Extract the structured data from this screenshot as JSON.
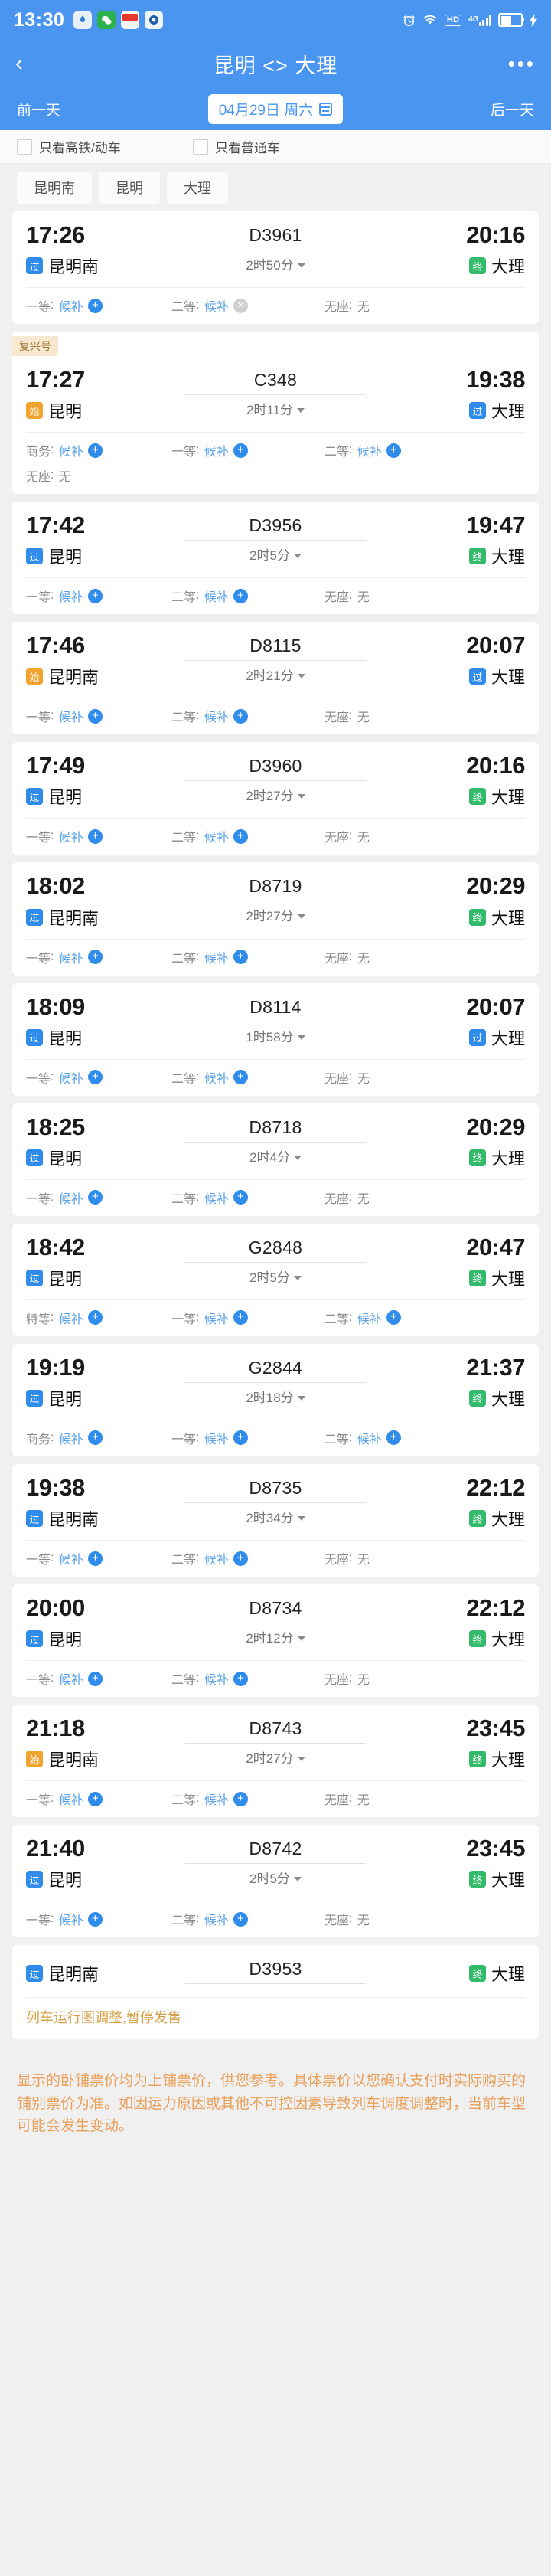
{
  "status_bar": {
    "time": "13:30",
    "app_icons": [
      "weather-icon",
      "wechat-icon",
      "toutiao-icon",
      "eye-icon"
    ],
    "right_icons": [
      "alarm-icon",
      "wifi-icon",
      "hd-icon",
      "signal-4g-icon",
      "battery-icon",
      "charging-icon"
    ],
    "hd_label": "HD",
    "network_label": "4G"
  },
  "nav": {
    "back_icon": "back-chevron-icon",
    "title": "昆明 <> 大理",
    "more_icon": "more-dots-icon"
  },
  "date_bar": {
    "prev_label": "前一天",
    "date_label": "04月29日 周六",
    "calendar_icon": "calendar-icon",
    "next_label": "后一天"
  },
  "filters": [
    {
      "label": "只看高铁/动车",
      "checked": false
    },
    {
      "label": "只看普通车",
      "checked": false
    }
  ],
  "station_tabs": [
    "昆明南",
    "昆明",
    "大理"
  ],
  "labels": {
    "fuxing_tag": "复兴号",
    "badge_pass": "过",
    "badge_start": "始",
    "badge_end": "终",
    "wait_text": "候补",
    "none_text": "无"
  },
  "trains": [
    {
      "tag": null,
      "depart_time": "17:26",
      "depart_station": "昆明南",
      "depart_badge": "过",
      "depart_badge_type": "guo",
      "code": "D3961",
      "duration": "2时50分",
      "arrive_time": "20:16",
      "arrive_station": "大理",
      "arrive_badge": "终",
      "arrive_badge_type": "zhong",
      "seat_rows": [
        [
          {
            "name": "一等",
            "value": "候补",
            "icon": "plus"
          },
          {
            "name": "二等",
            "value": "候补",
            "icon": "cross"
          },
          {
            "name": "无座",
            "value": "无",
            "icon": "none"
          }
        ]
      ],
      "notice": null
    },
    {
      "tag": "复兴号",
      "depart_time": "17:27",
      "depart_station": "昆明",
      "depart_badge": "始",
      "depart_badge_type": "shi",
      "code": "C348",
      "duration": "2时11分",
      "arrive_time": "19:38",
      "arrive_station": "大理",
      "arrive_badge": "过",
      "arrive_badge_type": "guo",
      "seat_rows": [
        [
          {
            "name": "商务",
            "value": "候补",
            "icon": "plus"
          },
          {
            "name": "一等",
            "value": "候补",
            "icon": "plus"
          },
          {
            "name": "二等",
            "value": "候补",
            "icon": "plus"
          }
        ],
        [
          {
            "name": "无座",
            "value": "无",
            "icon": "none"
          }
        ]
      ],
      "notice": null
    },
    {
      "tag": null,
      "depart_time": "17:42",
      "depart_station": "昆明",
      "depart_badge": "过",
      "depart_badge_type": "guo",
      "code": "D3956",
      "duration": "2时5分",
      "arrive_time": "19:47",
      "arrive_station": "大理",
      "arrive_badge": "终",
      "arrive_badge_type": "zhong",
      "seat_rows": [
        [
          {
            "name": "一等",
            "value": "候补",
            "icon": "plus"
          },
          {
            "name": "二等",
            "value": "候补",
            "icon": "plus"
          },
          {
            "name": "无座",
            "value": "无",
            "icon": "none"
          }
        ]
      ],
      "notice": null
    },
    {
      "tag": null,
      "depart_time": "17:46",
      "depart_station": "昆明南",
      "depart_badge": "始",
      "depart_badge_type": "shi",
      "code": "D8115",
      "duration": "2时21分",
      "arrive_time": "20:07",
      "arrive_station": "大理",
      "arrive_badge": "过",
      "arrive_badge_type": "guo",
      "seat_rows": [
        [
          {
            "name": "一等",
            "value": "候补",
            "icon": "plus"
          },
          {
            "name": "二等",
            "value": "候补",
            "icon": "plus"
          },
          {
            "name": "无座",
            "value": "无",
            "icon": "none"
          }
        ]
      ],
      "notice": null
    },
    {
      "tag": null,
      "depart_time": "17:49",
      "depart_station": "昆明",
      "depart_badge": "过",
      "depart_badge_type": "guo",
      "code": "D3960",
      "duration": "2时27分",
      "arrive_time": "20:16",
      "arrive_station": "大理",
      "arrive_badge": "终",
      "arrive_badge_type": "zhong",
      "seat_rows": [
        [
          {
            "name": "一等",
            "value": "候补",
            "icon": "plus"
          },
          {
            "name": "二等",
            "value": "候补",
            "icon": "plus"
          },
          {
            "name": "无座",
            "value": "无",
            "icon": "none"
          }
        ]
      ],
      "notice": null
    },
    {
      "tag": null,
      "depart_time": "18:02",
      "depart_station": "昆明南",
      "depart_badge": "过",
      "depart_badge_type": "guo",
      "code": "D8719",
      "duration": "2时27分",
      "arrive_time": "20:29",
      "arrive_station": "大理",
      "arrive_badge": "终",
      "arrive_badge_type": "zhong",
      "seat_rows": [
        [
          {
            "name": "一等",
            "value": "候补",
            "icon": "plus"
          },
          {
            "name": "二等",
            "value": "候补",
            "icon": "plus"
          },
          {
            "name": "无座",
            "value": "无",
            "icon": "none"
          }
        ]
      ],
      "notice": null
    },
    {
      "tag": null,
      "depart_time": "18:09",
      "depart_station": "昆明",
      "depart_badge": "过",
      "depart_badge_type": "guo",
      "code": "D8114",
      "duration": "1时58分",
      "arrive_time": "20:07",
      "arrive_station": "大理",
      "arrive_badge": "过",
      "arrive_badge_type": "guo",
      "seat_rows": [
        [
          {
            "name": "一等",
            "value": "候补",
            "icon": "plus"
          },
          {
            "name": "二等",
            "value": "候补",
            "icon": "plus"
          },
          {
            "name": "无座",
            "value": "无",
            "icon": "none"
          }
        ]
      ],
      "notice": null
    },
    {
      "tag": null,
      "depart_time": "18:25",
      "depart_station": "昆明",
      "depart_badge": "过",
      "depart_badge_type": "guo",
      "code": "D8718",
      "duration": "2时4分",
      "arrive_time": "20:29",
      "arrive_station": "大理",
      "arrive_badge": "终",
      "arrive_badge_type": "zhong",
      "seat_rows": [
        [
          {
            "name": "一等",
            "value": "候补",
            "icon": "plus"
          },
          {
            "name": "二等",
            "value": "候补",
            "icon": "plus"
          },
          {
            "name": "无座",
            "value": "无",
            "icon": "none"
          }
        ]
      ],
      "notice": null
    },
    {
      "tag": null,
      "depart_time": "18:42",
      "depart_station": "昆明",
      "depart_badge": "过",
      "depart_badge_type": "guo",
      "code": "G2848",
      "duration": "2时5分",
      "arrive_time": "20:47",
      "arrive_station": "大理",
      "arrive_badge": "终",
      "arrive_badge_type": "zhong",
      "seat_rows": [
        [
          {
            "name": "特等",
            "value": "候补",
            "icon": "plus"
          },
          {
            "name": "一等",
            "value": "候补",
            "icon": "plus"
          },
          {
            "name": "二等",
            "value": "候补",
            "icon": "plus"
          }
        ]
      ],
      "notice": null
    },
    {
      "tag": null,
      "depart_time": "19:19",
      "depart_station": "昆明",
      "depart_badge": "过",
      "depart_badge_type": "guo",
      "code": "G2844",
      "duration": "2时18分",
      "arrive_time": "21:37",
      "arrive_station": "大理",
      "arrive_badge": "终",
      "arrive_badge_type": "zhong",
      "seat_rows": [
        [
          {
            "name": "商务",
            "value": "候补",
            "icon": "plus"
          },
          {
            "name": "一等",
            "value": "候补",
            "icon": "plus"
          },
          {
            "name": "二等",
            "value": "候补",
            "icon": "plus"
          }
        ]
      ],
      "notice": null
    },
    {
      "tag": null,
      "depart_time": "19:38",
      "depart_station": "昆明南",
      "depart_badge": "过",
      "depart_badge_type": "guo",
      "code": "D8735",
      "duration": "2时34分",
      "arrive_time": "22:12",
      "arrive_station": "大理",
      "arrive_badge": "终",
      "arrive_badge_type": "zhong",
      "seat_rows": [
        [
          {
            "name": "一等",
            "value": "候补",
            "icon": "plus"
          },
          {
            "name": "二等",
            "value": "候补",
            "icon": "plus"
          },
          {
            "name": "无座",
            "value": "无",
            "icon": "none"
          }
        ]
      ],
      "notice": null
    },
    {
      "tag": null,
      "depart_time": "20:00",
      "depart_station": "昆明",
      "depart_badge": "过",
      "depart_badge_type": "guo",
      "code": "D8734",
      "duration": "2时12分",
      "arrive_time": "22:12",
      "arrive_station": "大理",
      "arrive_badge": "终",
      "arrive_badge_type": "zhong",
      "seat_rows": [
        [
          {
            "name": "一等",
            "value": "候补",
            "icon": "plus"
          },
          {
            "name": "二等",
            "value": "候补",
            "icon": "plus"
          },
          {
            "name": "无座",
            "value": "无",
            "icon": "none"
          }
        ]
      ],
      "notice": null
    },
    {
      "tag": null,
      "depart_time": "21:18",
      "depart_station": "昆明南",
      "depart_badge": "始",
      "depart_badge_type": "shi",
      "code": "D8743",
      "duration": "2时27分",
      "arrive_time": "23:45",
      "arrive_station": "大理",
      "arrive_badge": "终",
      "arrive_badge_type": "zhong",
      "seat_rows": [
        [
          {
            "name": "一等",
            "value": "候补",
            "icon": "plus"
          },
          {
            "name": "二等",
            "value": "候补",
            "icon": "plus"
          },
          {
            "name": "无座",
            "value": "无",
            "icon": "none"
          }
        ]
      ],
      "notice": null
    },
    {
      "tag": null,
      "depart_time": "21:40",
      "depart_station": "昆明",
      "depart_badge": "过",
      "depart_badge_type": "guo",
      "code": "D8742",
      "duration": "2时5分",
      "arrive_time": "23:45",
      "arrive_station": "大理",
      "arrive_badge": "终",
      "arrive_badge_type": "zhong",
      "seat_rows": [
        [
          {
            "name": "一等",
            "value": "候补",
            "icon": "plus"
          },
          {
            "name": "二等",
            "value": "候补",
            "icon": "plus"
          },
          {
            "name": "无座",
            "value": "无",
            "icon": "none"
          }
        ]
      ],
      "notice": null
    },
    {
      "tag": null,
      "depart_time": "",
      "depart_station": "昆明南",
      "depart_badge": "过",
      "depart_badge_type": "guo",
      "code": "D3953",
      "duration": "",
      "arrive_time": "",
      "arrive_station": "大理",
      "arrive_badge": "终",
      "arrive_badge_type": "zhong",
      "seat_rows": [],
      "notice": "列车运行图调整,暂停发售"
    }
  ],
  "footer": {
    "disclaimer": "显示的卧铺票价均为上铺票价，供您参考。具体票价以您确认支付时实际购买的铺别票价为准。如因运力原因或其他不可控因素导致列车调度调整时，当前车型可能会发生变动。"
  }
}
